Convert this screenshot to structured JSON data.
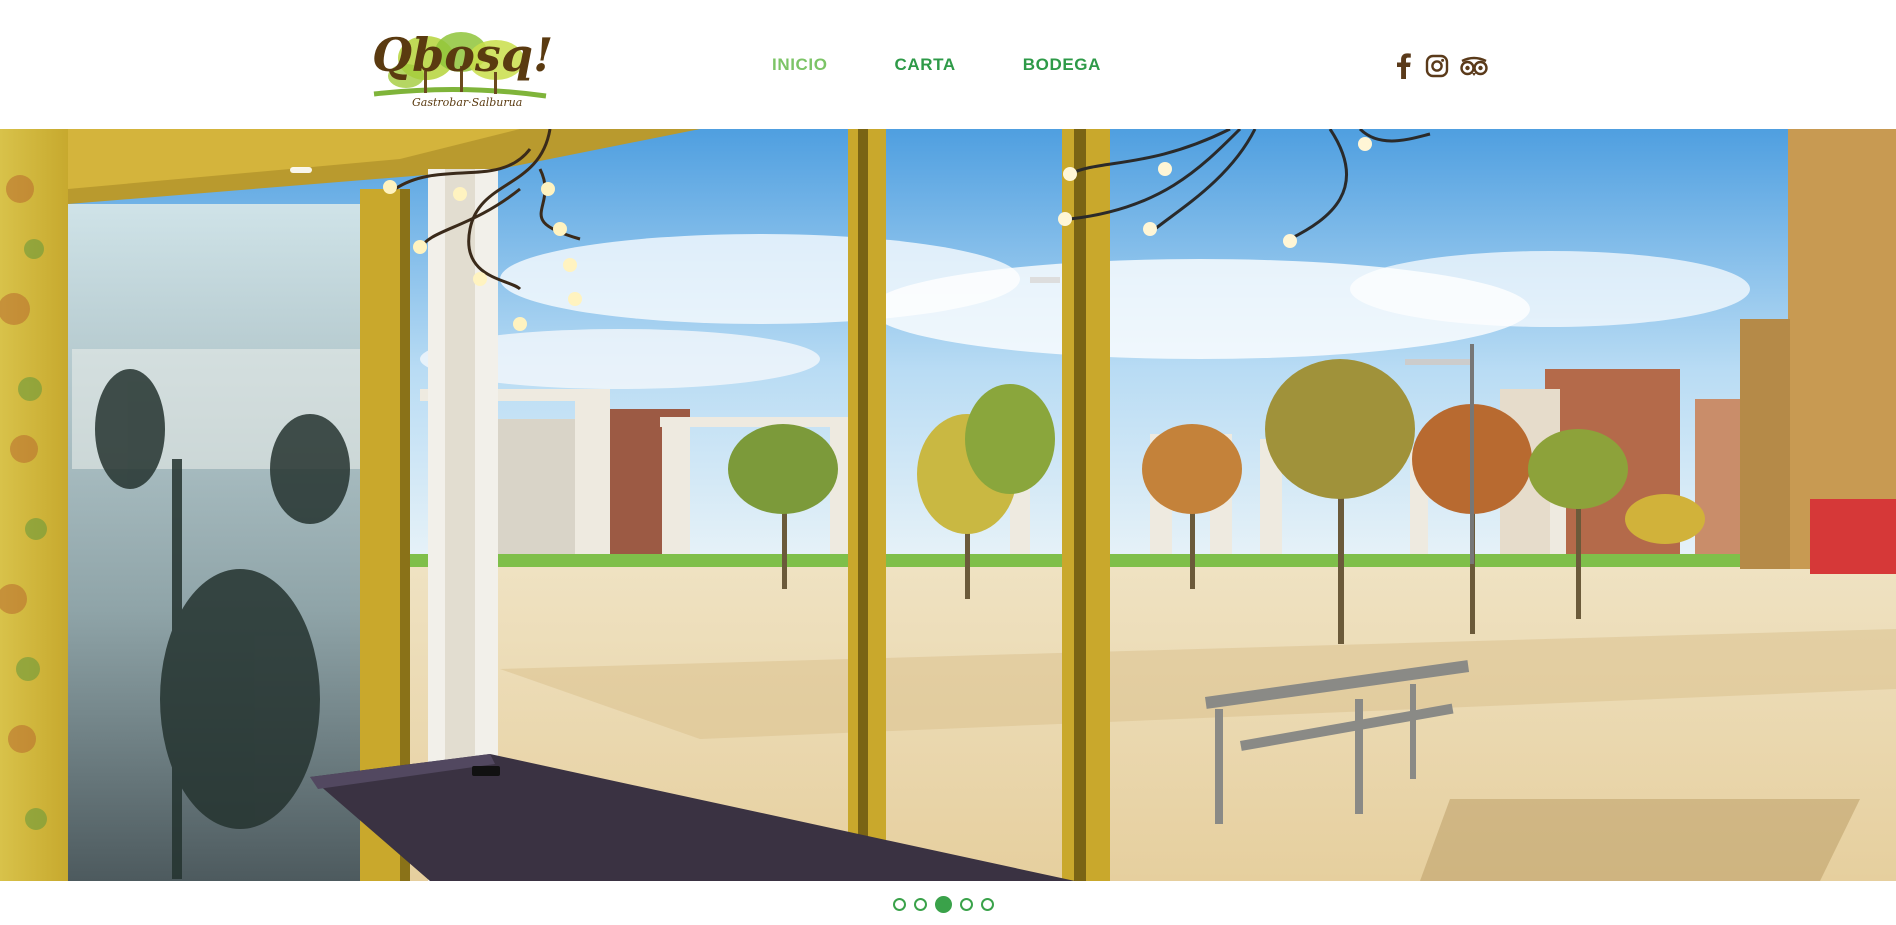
{
  "brand": {
    "logo_text": "Qbosq!",
    "logo_subtitle": "Gastrobar·Salburua"
  },
  "nav": {
    "items": [
      {
        "label": "INICIO",
        "active": true
      },
      {
        "label": "CARTA",
        "active": false
      },
      {
        "label": "BODEGA",
        "active": false
      }
    ]
  },
  "social": {
    "icons": [
      "facebook-icon",
      "instagram-icon",
      "tripadvisor-icon"
    ]
  },
  "slider": {
    "slide_count": 5,
    "active_slide": 3
  },
  "colors": {
    "nav_green": "#2e9a48",
    "nav_active": "#7cc466",
    "icon_brown": "#5a3a1a",
    "dot_green": "#3aa24a"
  }
}
